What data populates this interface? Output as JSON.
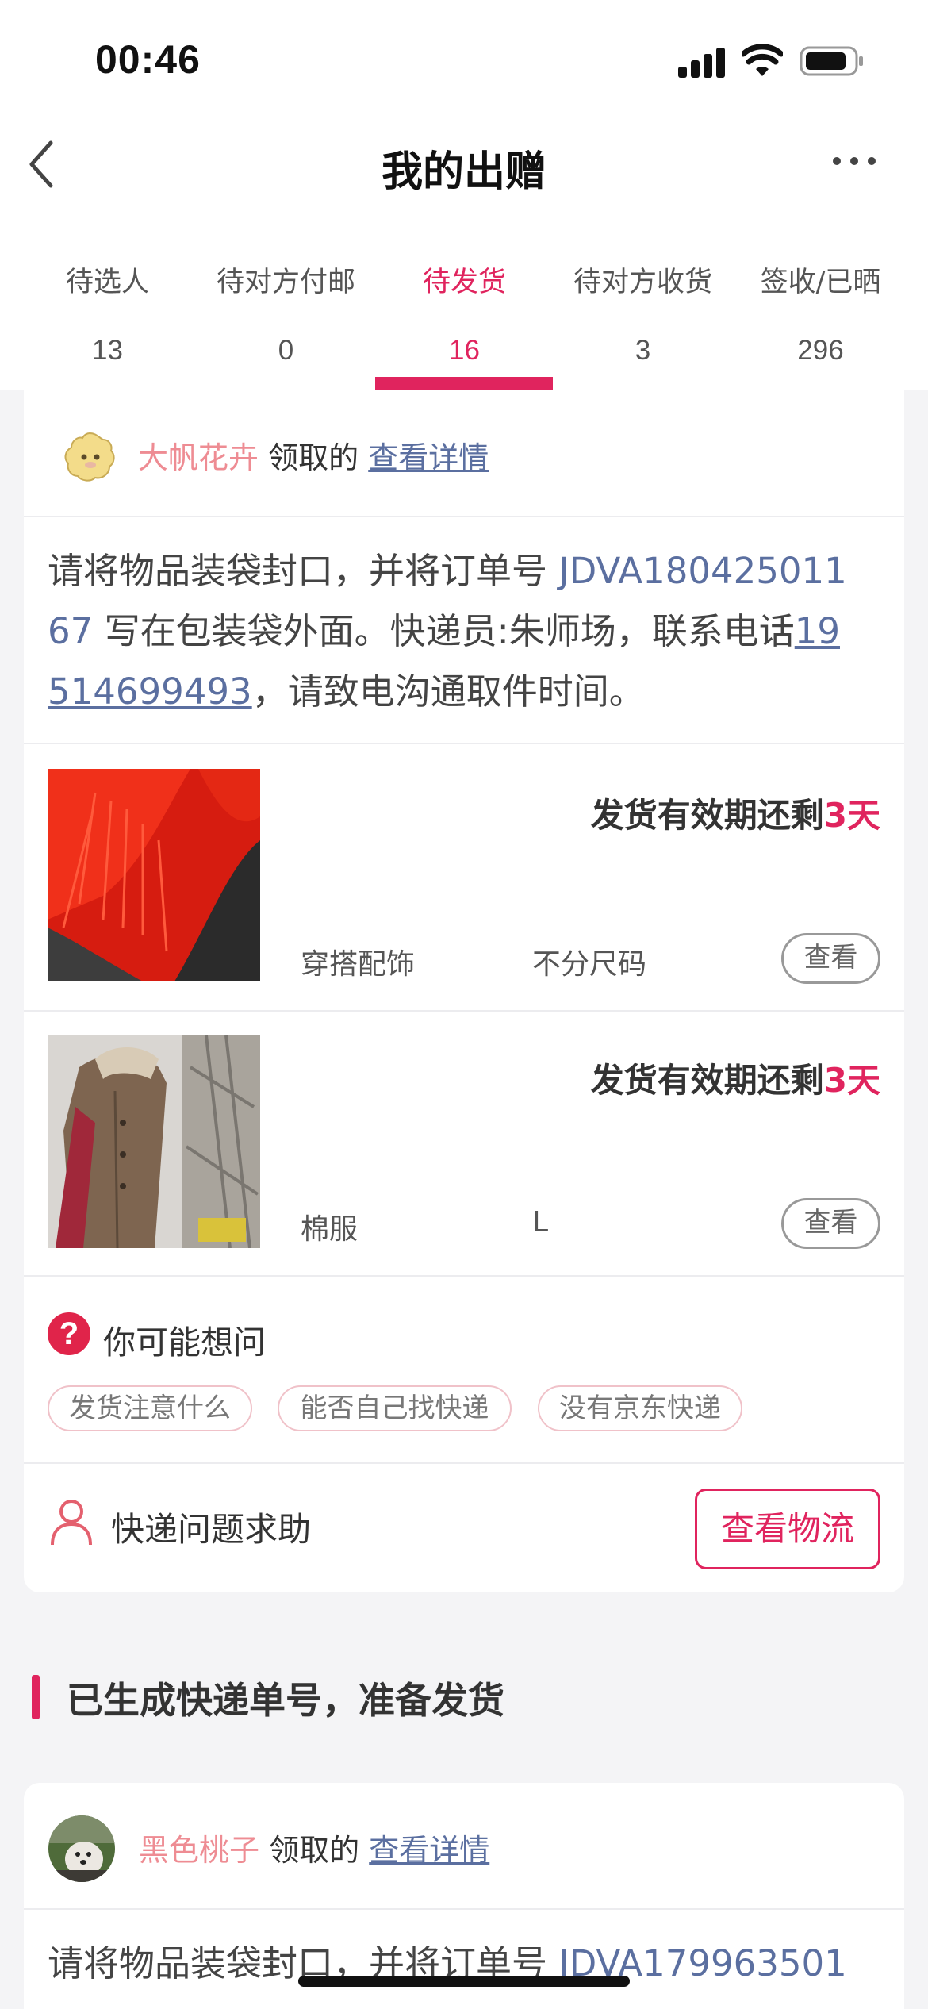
{
  "status_bar": {
    "time": "00:46"
  },
  "nav": {
    "title": "我的出赠",
    "back_icon": "chevron-left-icon",
    "more_icon": "more-dots-icon"
  },
  "tabs": [
    {
      "label": "待选人",
      "count": "13"
    },
    {
      "label": "待对方付邮",
      "count": "0"
    },
    {
      "label": "待发货",
      "count": "16",
      "active": true
    },
    {
      "label": "待对方收货",
      "count": "3"
    },
    {
      "label": "签收/已晒",
      "count": "296"
    }
  ],
  "order1": {
    "giver_name": "大帆花卉",
    "giver_action": "领取的",
    "detail_link": "查看详情",
    "instruction": {
      "prefix": "请将物品装袋封口，并将订单号 ",
      "order_no_a": "JDVA180425011",
      "order_no_b": "67",
      "middle": " 写在包装袋外面。快递员:朱师场，联系电话",
      "phone_a": "19",
      "phone_b": "514699493",
      "suffix": "，请致电沟通取件时间。"
    },
    "items": [
      {
        "expiry_prefix": "发货有效期还剩",
        "expiry_days": "3天",
        "category": "穿搭配饰",
        "size": "不分尺码",
        "view_label": "查看"
      },
      {
        "expiry_prefix": "发货有效期还剩",
        "expiry_days": "3天",
        "category": "棉服",
        "size": "L",
        "view_label": "查看"
      }
    ],
    "faq": {
      "title": "你可能想问",
      "icon": "question-circle-icon",
      "chips": [
        "发货注意什么",
        "能否自己找快递",
        "没有京东快递"
      ]
    },
    "help": {
      "label": "快递问题求助",
      "icon": "person-icon",
      "logistics_button": "查看物流"
    }
  },
  "section": {
    "title": "已生成快递单号，准备发货"
  },
  "order2": {
    "giver_name": "黑色桃子",
    "giver_action": "领取的",
    "detail_link": "查看详情",
    "instruction_prefix": "请将物品装袋封口，并将订单号 ",
    "order_no": "JDVA179963501"
  },
  "colors": {
    "accent": "#e0245e",
    "link": "#5b6fa0",
    "giver_name": "#ee8c93"
  }
}
